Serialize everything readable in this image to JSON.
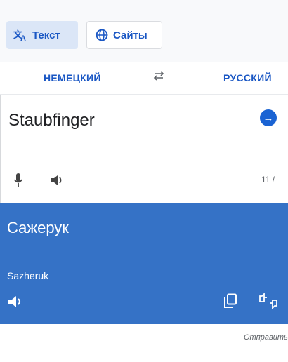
{
  "tabs": {
    "text_label": "Текст",
    "sites_label": "Сайты"
  },
  "languages": {
    "source": "НЕМЕЦКИЙ",
    "target": "РУССКИЙ"
  },
  "source": {
    "text": "Staubfinger",
    "char_counter": "11 /"
  },
  "result": {
    "text": "Сажерук",
    "transliteration": "Sazheruk"
  },
  "footer": {
    "send_feedback": "Отправить"
  },
  "colors": {
    "accent": "#1a57c4",
    "result_bg": "#3572c6",
    "tab_active_bg": "#dbe6f7"
  }
}
